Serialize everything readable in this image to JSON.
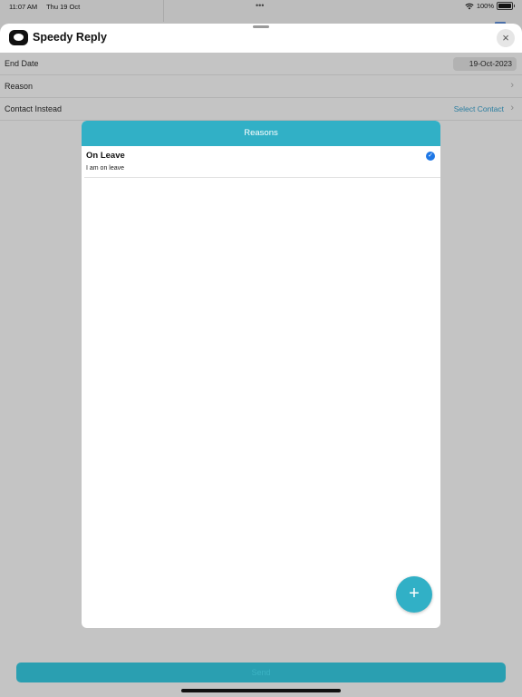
{
  "status_bar": {
    "time": "11:07 AM",
    "date": "Thu 19 Oct",
    "dots": "•••",
    "battery": "100%"
  },
  "header": {
    "title": "Speedy Reply",
    "close_icon": "×"
  },
  "form": {
    "end_date_label": "End Date",
    "end_date_value": "19-Oct-2023",
    "reason_label": "Reason",
    "contact_label": "Contact Instead",
    "contact_value": "Select Contact",
    "chevron": "›"
  },
  "modal": {
    "title": "Reasons",
    "items": [
      {
        "title": "On Leave",
        "description": "I am on leave",
        "selected": true
      }
    ],
    "check_icon": "✓",
    "add_icon": "+"
  },
  "footer": {
    "send_label": "Send"
  },
  "colors": {
    "accent": "#31b0c6",
    "check": "#1f78e6",
    "link": "#2b7ea0"
  }
}
